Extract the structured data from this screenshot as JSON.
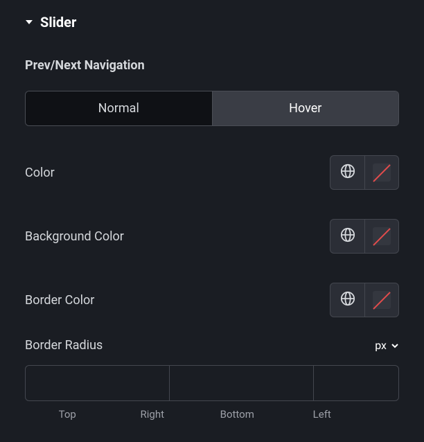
{
  "section": {
    "title": "Slider"
  },
  "subheading": "Prev/Next Navigation",
  "tabs": {
    "normal": "Normal",
    "hover": "Hover",
    "active": "hover"
  },
  "controls": {
    "color": {
      "label": "Color"
    },
    "bg": {
      "label": "Background Color"
    },
    "border": {
      "label": "Border Color"
    }
  },
  "radius": {
    "label": "Border Radius",
    "unit": "px",
    "sides": {
      "top": "Top",
      "right": "Right",
      "bottom": "Bottom",
      "left": "Left"
    },
    "values": {
      "top": "",
      "right": "",
      "bottom": "",
      "left": ""
    }
  }
}
